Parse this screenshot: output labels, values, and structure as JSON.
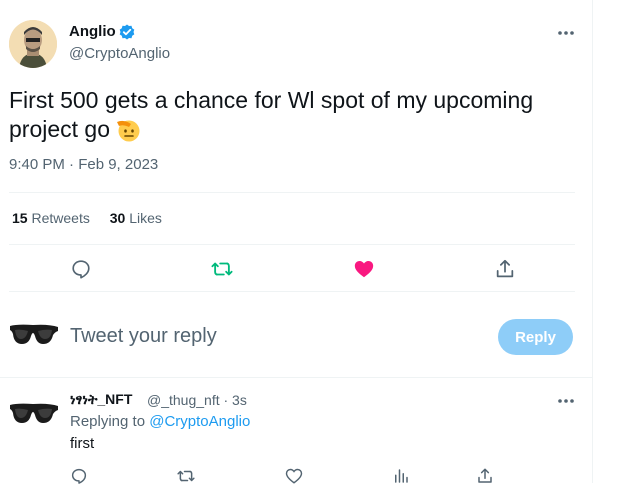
{
  "tweet": {
    "author_name": "Anglio",
    "author_handle": "@CryptoAnglio",
    "text": "First 500 gets a chance for Wl spot of my upcoming project go",
    "timestamp": "9:40 PM · Feb 9, 2023",
    "retweets_count": "15",
    "retweets_label": "Retweets",
    "likes_count": "30",
    "likes_label": "Likes",
    "liked": true
  },
  "composer": {
    "placeholder": "Tweet your reply",
    "reply_button": "Reply"
  },
  "reply": {
    "author_name": "ነፃነት_NFT",
    "author_handle": "@_thug_nft",
    "age": "· 3s",
    "replying_to_label": "Replying to",
    "replying_to_handle": "@CryptoAnglio",
    "text": "first"
  },
  "colors": {
    "brand_blue": "#1d9bf0",
    "retweet_green": "#00ba7c",
    "like_pink": "#f91880",
    "muted": "#536471"
  }
}
